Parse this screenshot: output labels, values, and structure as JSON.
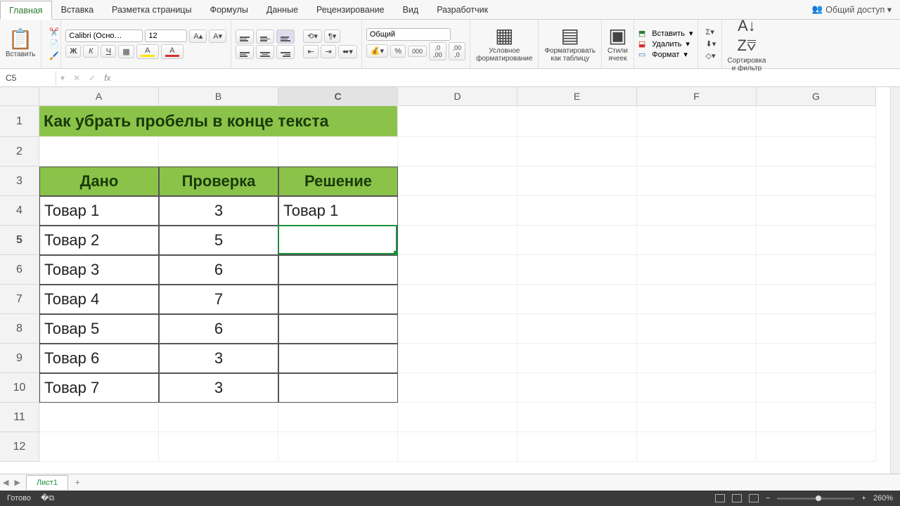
{
  "menu": {
    "tabs": [
      "Главная",
      "Вставка",
      "Разметка страницы",
      "Формулы",
      "Данные",
      "Рецензирование",
      "Вид",
      "Разработчик"
    ],
    "active": 0,
    "share": "Общий доступ"
  },
  "ribbon": {
    "paste": "Вставить",
    "font_name": "Calibri (Осно…",
    "font_size": "12",
    "number_format": "Общий",
    "cond_format": "Условное\nформатирование",
    "format_table": "Форматировать\nкак таблицу",
    "cell_styles": "Стили\nячеек",
    "insert": "Вставить",
    "delete": "Удалить",
    "format": "Формат",
    "sort": "Сортировка\nи фильтр"
  },
  "formula_bar": {
    "cell_ref": "C5",
    "formula": ""
  },
  "columns": [
    "A",
    "B",
    "C",
    "D",
    "E",
    "F",
    "G"
  ],
  "rows": {
    "1": {
      "height": "r1",
      "cells": {
        "A": {
          "text": "Как убрать пробелы в конце текста",
          "span": 3,
          "cls": "title-cell"
        }
      }
    },
    "2": {
      "cells": {}
    },
    "3": {
      "cells": {
        "A": {
          "text": "Дано",
          "cls": "table-hdr"
        },
        "B": {
          "text": "Проверка",
          "cls": "table-hdr"
        },
        "C": {
          "text": "Решение",
          "cls": "table-hdr"
        }
      }
    },
    "4": {
      "cells": {
        "A": {
          "text": "Товар 1",
          "cls": "table-cell"
        },
        "B": {
          "text": "3",
          "cls": "table-cell center"
        },
        "C": {
          "text": "Товар 1",
          "cls": "table-cell"
        }
      }
    },
    "5": {
      "cells": {
        "A": {
          "text": "Товар 2",
          "cls": "table-cell"
        },
        "B": {
          "text": "5",
          "cls": "table-cell center"
        },
        "C": {
          "text": "",
          "cls": "table-cell"
        }
      }
    },
    "6": {
      "cells": {
        "A": {
          "text": "Товар 3",
          "cls": "table-cell"
        },
        "B": {
          "text": "6",
          "cls": "table-cell center"
        },
        "C": {
          "text": "",
          "cls": "table-cell"
        }
      }
    },
    "7": {
      "cells": {
        "A": {
          "text": "Товар 4",
          "cls": "table-cell"
        },
        "B": {
          "text": "7",
          "cls": "table-cell center"
        },
        "C": {
          "text": "",
          "cls": "table-cell"
        }
      }
    },
    "8": {
      "cells": {
        "A": {
          "text": "Товар 5",
          "cls": "table-cell"
        },
        "B": {
          "text": "6",
          "cls": "table-cell center"
        },
        "C": {
          "text": "",
          "cls": "table-cell"
        }
      }
    },
    "9": {
      "cells": {
        "A": {
          "text": "Товар 6",
          "cls": "table-cell"
        },
        "B": {
          "text": "3",
          "cls": "table-cell center"
        },
        "C": {
          "text": "",
          "cls": "table-cell"
        }
      }
    },
    "10": {
      "cells": {
        "A": {
          "text": "Товар 7",
          "cls": "table-cell"
        },
        "B": {
          "text": "3",
          "cls": "table-cell center"
        },
        "C": {
          "text": "",
          "cls": "table-cell"
        }
      }
    },
    "11": {
      "cells": {}
    },
    "12": {
      "cells": {}
    }
  },
  "selected": {
    "row": 5,
    "col": "C"
  },
  "sheet_tab": "Лист1",
  "status": {
    "ready": "Готово",
    "zoom": "260%"
  }
}
